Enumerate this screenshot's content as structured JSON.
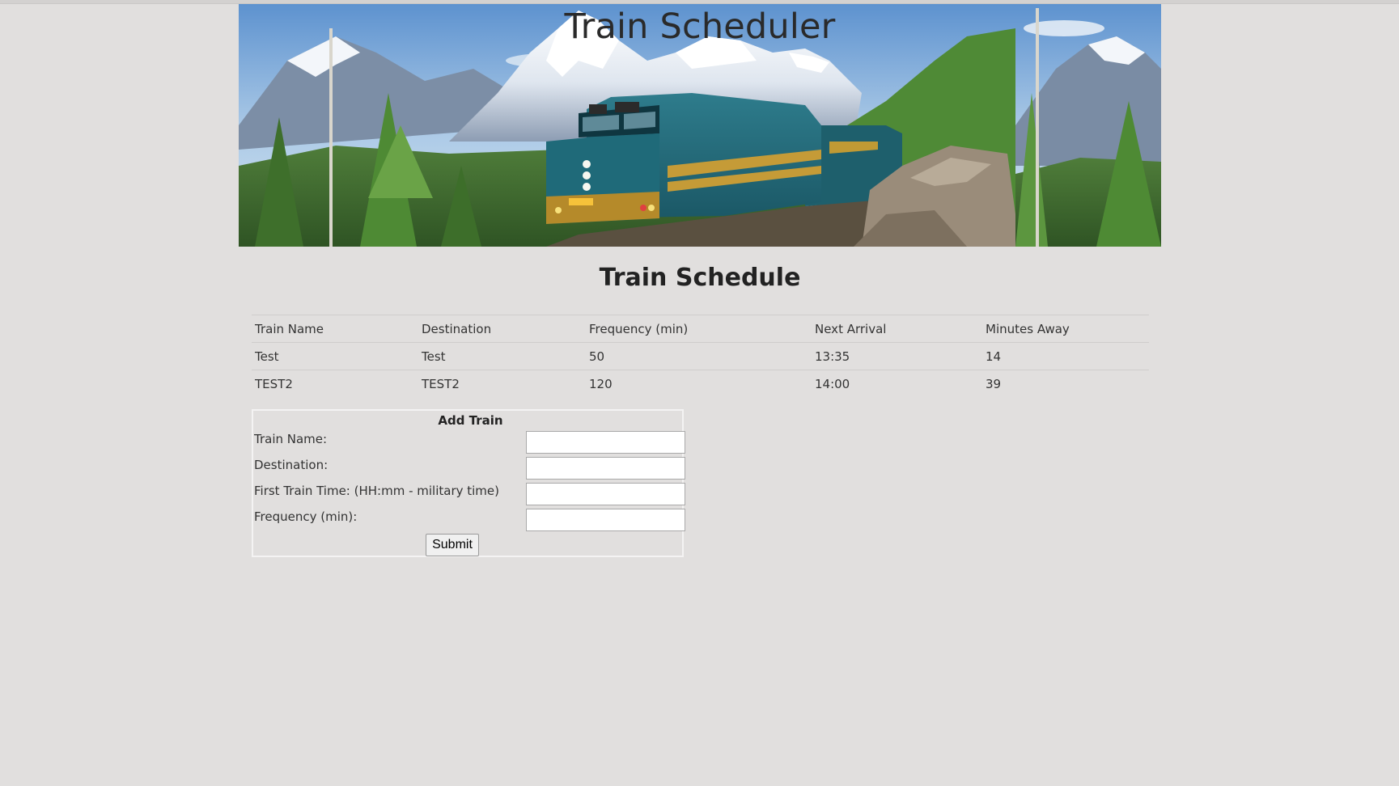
{
  "header": {
    "title": "Train Scheduler",
    "banner_image": "mountain-train-landscape"
  },
  "schedule": {
    "heading": "Train Schedule",
    "columns": [
      "Train Name",
      "Destination",
      "Frequency (min)",
      "Next Arrival",
      "Minutes Away"
    ],
    "rows": [
      [
        "Test",
        "Test",
        "50",
        "13:35",
        "14"
      ],
      [
        "TEST2",
        "TEST2",
        "120",
        "14:00",
        "39"
      ]
    ]
  },
  "form": {
    "title": "Add Train",
    "fields": {
      "train_name": {
        "label": "Train Name:",
        "value": ""
      },
      "destination": {
        "label": "Destination:",
        "value": ""
      },
      "first_train_time": {
        "label": "First Train Time: (HH:mm - military time)",
        "value": ""
      },
      "frequency": {
        "label": "Frequency (min):",
        "value": ""
      }
    },
    "submit_label": "Submit"
  }
}
